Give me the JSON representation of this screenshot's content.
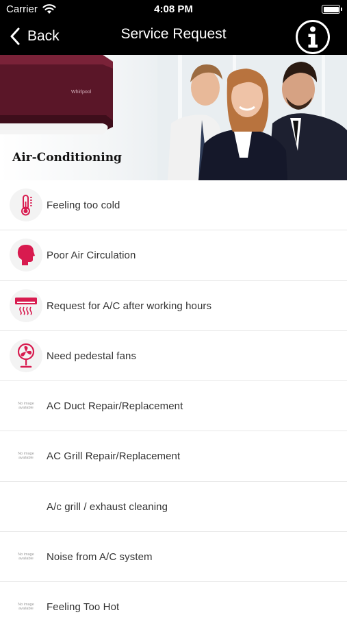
{
  "status_bar": {
    "carrier": "Carrier",
    "time": "4:08 PM"
  },
  "nav": {
    "back_label": "Back",
    "title": "Service Request"
  },
  "banner": {
    "title": "Air-Conditioning"
  },
  "colors": {
    "accent": "#d81b4f",
    "bar": "#000000"
  },
  "items": [
    {
      "label": "Feeling too cold",
      "icon": "thermometer-icon"
    },
    {
      "label": "Poor Air Circulation",
      "icon": "head-breathing-icon"
    },
    {
      "label": "Request for A/C after working hours",
      "icon": "ac-unit-icon"
    },
    {
      "label": "Need pedestal fans",
      "icon": "pedestal-fan-icon"
    },
    {
      "label": "AC Duct Repair/Replacement",
      "icon": "no-image-icon",
      "noimg_line1": "No image",
      "noimg_line2": "available"
    },
    {
      "label": "AC Grill Repair/Replacement",
      "icon": "no-image-icon",
      "noimg_line1": "No image",
      "noimg_line2": "available"
    },
    {
      "label": "A/c grill / exhaust cleaning",
      "icon": "none"
    },
    {
      "label": "Noise from A/C system",
      "icon": "no-image-icon",
      "noimg_line1": "No image",
      "noimg_line2": "available"
    },
    {
      "label": "Feeling Too Hot",
      "icon": "no-image-icon",
      "noimg_line1": "No image",
      "noimg_line2": "available"
    }
  ]
}
